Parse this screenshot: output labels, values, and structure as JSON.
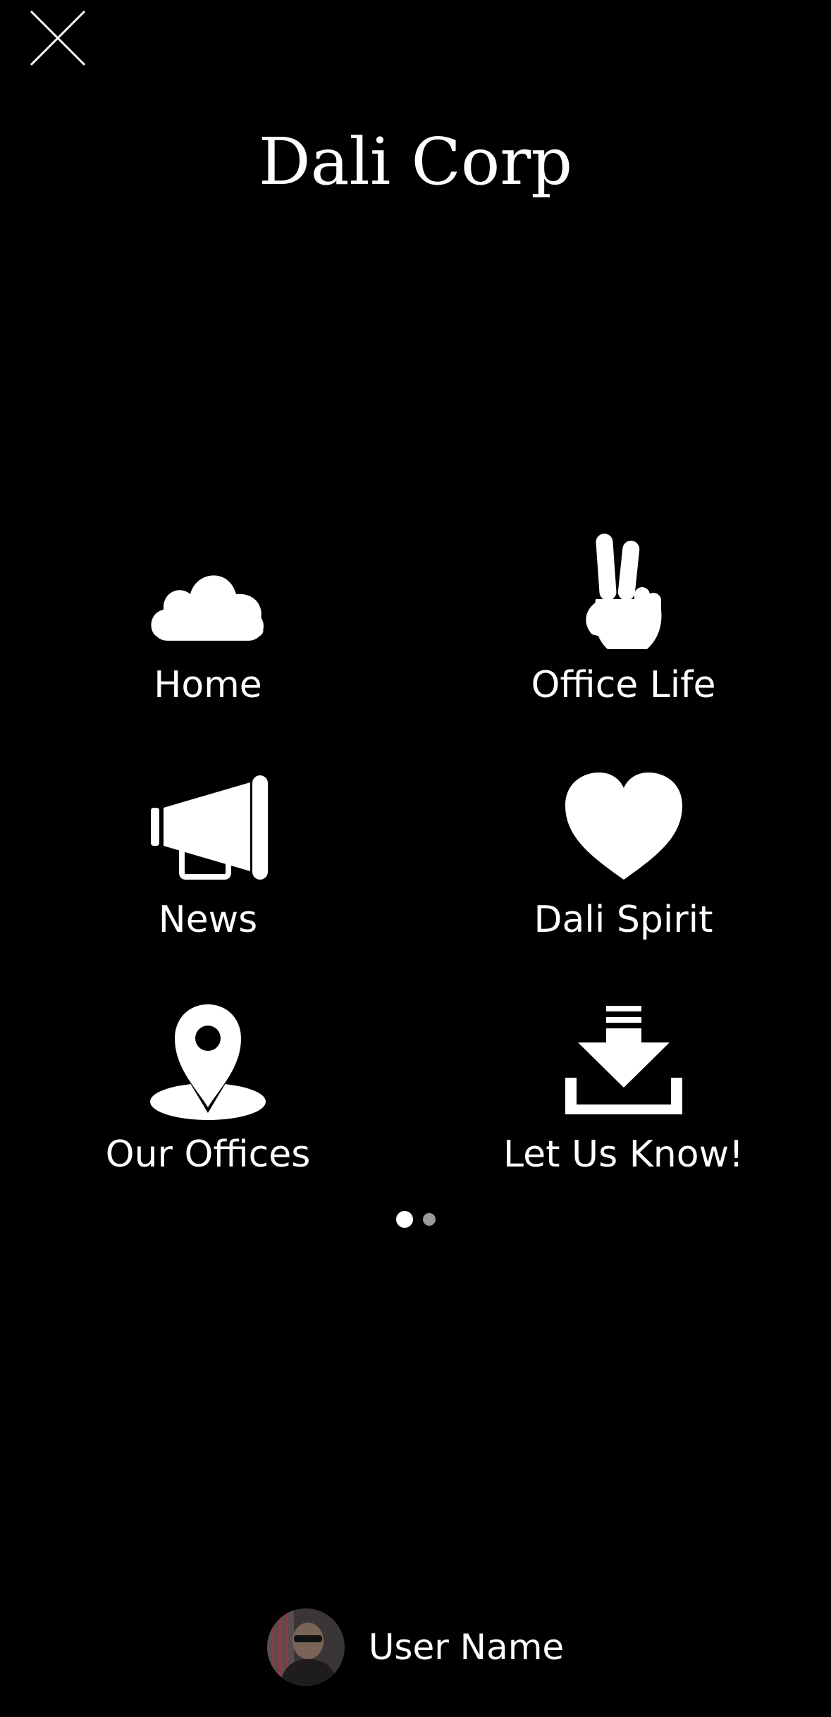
{
  "header": {
    "title": "Dali Corp",
    "close_icon": "close-icon"
  },
  "menu": {
    "items": [
      {
        "label": "Home",
        "icon": "cloud-icon"
      },
      {
        "label": "Office Life",
        "icon": "peace-hand-icon"
      },
      {
        "label": "News",
        "icon": "megaphone-icon"
      },
      {
        "label": "Dali Spirit",
        "icon": "heart-icon"
      },
      {
        "label": "Our Offices",
        "icon": "map-pin-icon"
      },
      {
        "label": "Let Us Know!",
        "icon": "download-tray-icon"
      }
    ]
  },
  "pagination": {
    "current_page": 1,
    "total_pages": 2
  },
  "user": {
    "name": "User Name",
    "avatar_icon": "avatar"
  },
  "colors": {
    "background": "#000000",
    "foreground": "#ffffff",
    "inactive_dot": "#9a9a9a"
  }
}
